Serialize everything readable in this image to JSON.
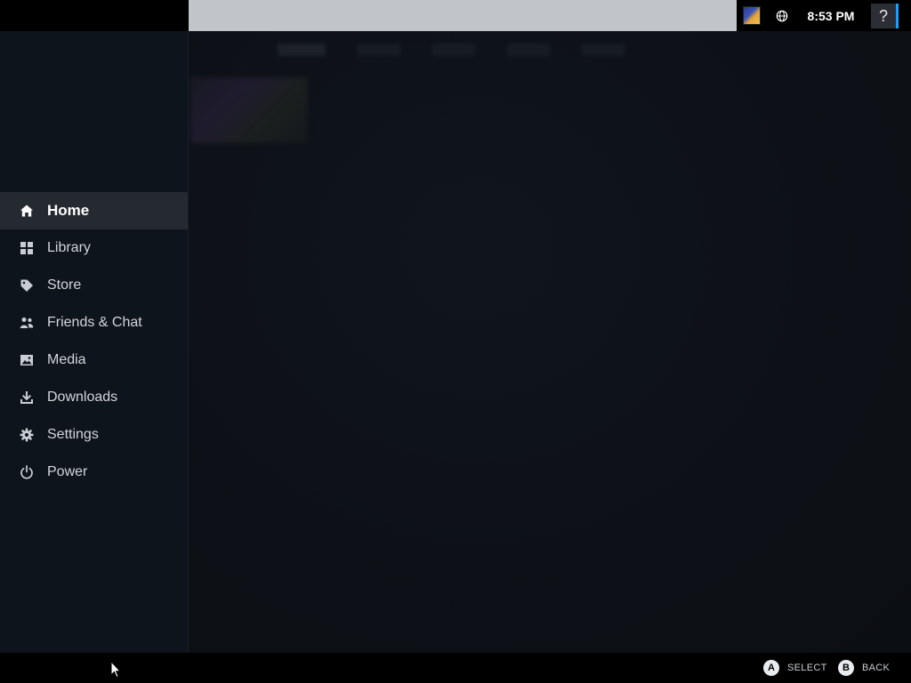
{
  "topbar": {
    "time": "8:53 PM",
    "help_label": "?",
    "running_game_icon": "game-thumbnail-icon",
    "network_icon": "globe-icon"
  },
  "sidebar": {
    "items": [
      {
        "label": "Home",
        "icon": "home-icon",
        "active": true
      },
      {
        "label": "Library",
        "icon": "grid-icon",
        "active": false
      },
      {
        "label": "Store",
        "icon": "tag-icon",
        "active": false
      },
      {
        "label": "Friends & Chat",
        "icon": "people-icon",
        "active": false
      },
      {
        "label": "Media",
        "icon": "image-icon",
        "active": false
      },
      {
        "label": "Downloads",
        "icon": "download-icon",
        "active": false
      },
      {
        "label": "Settings",
        "icon": "gear-icon",
        "active": false
      },
      {
        "label": "Power",
        "icon": "power-icon",
        "active": false
      }
    ]
  },
  "footer": {
    "a_button": "A",
    "a_label": "SELECT",
    "b_button": "B",
    "b_label": "BACK"
  },
  "colors": {
    "sidebar_bg": "#0e141b",
    "active_item_bg": "#252a31",
    "accent": "#1a9fff",
    "topbar_gray": "#c1c4c8"
  }
}
